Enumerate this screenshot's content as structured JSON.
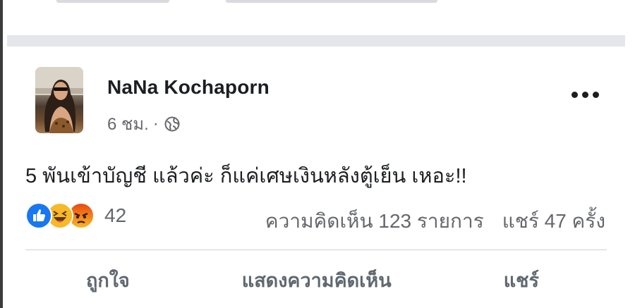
{
  "post": {
    "author": "NaNa Kochaporn",
    "time": "6 ชม.",
    "separator": "·",
    "privacy_icon": "globe-icon",
    "more_icon": "more-options-icon",
    "text": "5 พันเข้าบัญชี แล้วค่ะ ก็แค่เศษเงินหลังตู้เย็น เหอะ!!"
  },
  "stats": {
    "reactions": [
      "like-reaction-icon",
      "haha-reaction-icon",
      "angry-reaction-icon"
    ],
    "reaction_count": "42",
    "comments": "ความคิดเห็น 123 รายการ",
    "shares": "แชร์ 47 ครั้ง"
  },
  "actions": {
    "like_label": "ถูกใจ",
    "comment_label": "แสดงความคิดเห็น",
    "share_label": "แชร์"
  },
  "colors": {
    "like_blue": "#1877f2",
    "haha_yellow": "#f7b928",
    "angry_orange": "#e9710f",
    "text_primary": "#1c1e21",
    "text_secondary": "#65676b"
  }
}
